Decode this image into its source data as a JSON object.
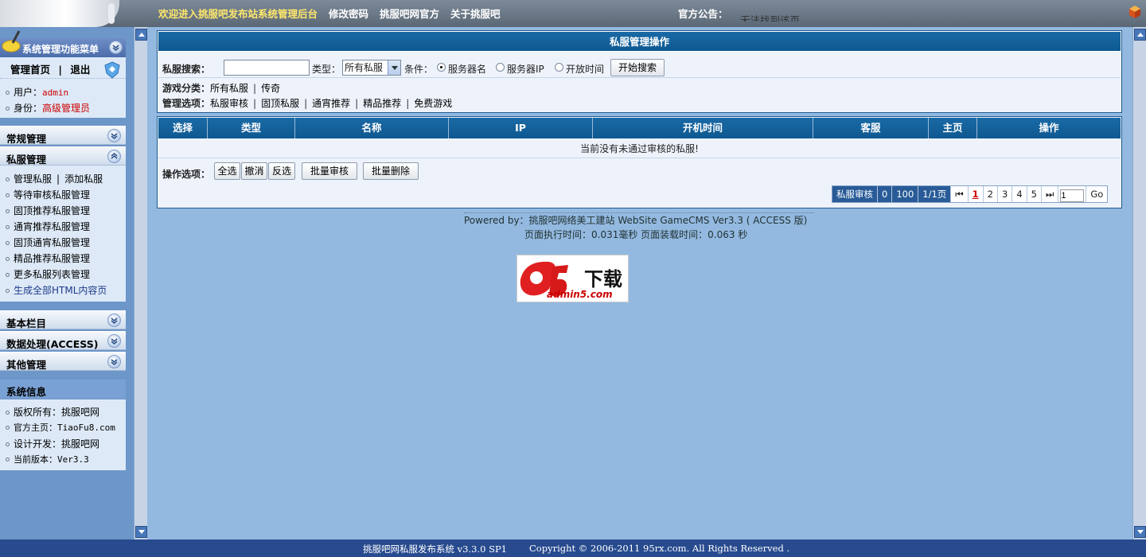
{
  "topbar": {
    "welcome": "欢迎进入挑服吧发布站系统管理后台",
    "nav": [
      "修改密码",
      "挑服吧网官方",
      "关于挑服吧"
    ],
    "announce_label": "官方公告：",
    "announce_text": "无法找到该页"
  },
  "sidebar": {
    "menu_title": "系统管理功能菜单",
    "home": "管理首页",
    "home_sep": "|",
    "logout": "退出",
    "user_label": "用户：",
    "user_value": "admin",
    "role_label": "身份：",
    "role_value": "高级管理员",
    "sections": {
      "normal": "常规管理",
      "private": "私服管理",
      "basic": "基本栏目",
      "data": "数据处理(ACCESS)",
      "other": "其他管理",
      "sysinfo": "系统信息"
    },
    "private_items": {
      "manage": "管理私服",
      "sep": "|",
      "add": "添加私服",
      "i2": "等待审核私服管理",
      "i3": "固顶推荐私服管理",
      "i4": "通宵推荐私服管理",
      "i5": "固顶通宵私服管理",
      "i6": "精品推荐私服管理",
      "i7": "更多私服列表管理",
      "i8": "生成全部HTML内容页"
    },
    "sysinfo_items": {
      "copyright": "版权所有：挑服吧网",
      "homepage": "官方主页：TiaoFu8.com",
      "dev": "设计开发：挑服吧网",
      "version": "当前版本：Ver3.3"
    }
  },
  "panel": {
    "title": "私服管理操作",
    "search_label": "私服搜索：",
    "search_value": "",
    "type_label": "类型：",
    "type_selected": "所有私服",
    "cond_label": "条件：",
    "radios": [
      "服务器名",
      "服务器IP",
      "开放时间"
    ],
    "search_button": "开始搜索",
    "game_cat_label": "游戏分类：",
    "game_cats": [
      "所有私服",
      "传奇"
    ],
    "mgmt_label": "管理选项：",
    "mgmt_opts": [
      "私服审核",
      "固顶私服",
      "通宵推荐",
      "精品推荐",
      "免费游戏"
    ]
  },
  "table": {
    "headers": [
      "选择",
      "类型",
      "名称",
      "IP",
      "开机时间",
      "客服",
      "主页",
      "操作"
    ],
    "empty_text": "当前没有未通过审核的私服!",
    "ops_label": "操作选项：",
    "ops_buttons": [
      "全选",
      "撤消",
      "反选"
    ],
    "batch_review": "批量审核",
    "batch_delete": "批量删除"
  },
  "pager": {
    "label": "私服审核",
    "count": "0",
    "per_page": "100",
    "pages": "1/1页",
    "numbers": [
      "1",
      "2",
      "3",
      "4",
      "5"
    ],
    "current": "1",
    "input_value": "1",
    "go": "Go"
  },
  "footer": {
    "powered": "Powered by：挑服吧网络美工建站  WebSite GameCMS Ver3.3 ( ACCESS 版)",
    "timing": "页面执行时间：0.031毫秒   页面装载时间：0.063 秒",
    "logo_text": "下载",
    "logo_sub": "admin5.com",
    "bottom_left": "挑服吧网私服发布系统 v3.3.0 SP1",
    "bottom_right": "Copyright © 2006-2011 95rx.com. All Rights Reserved ."
  }
}
